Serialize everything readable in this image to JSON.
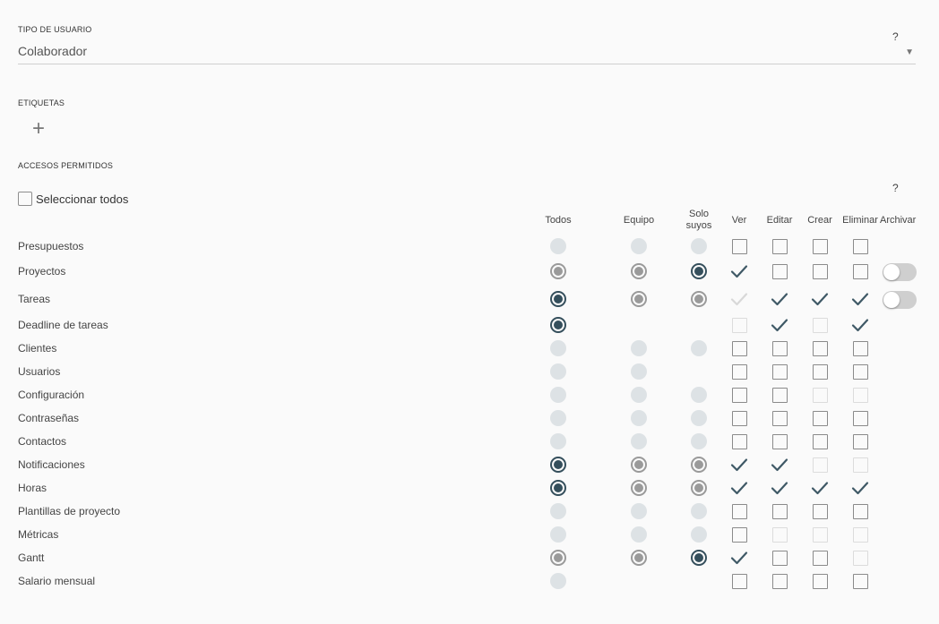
{
  "tipo_usuario": {
    "label": "TIPO DE USUARIO",
    "value": "Colaborador",
    "help": "?"
  },
  "etiquetas": {
    "label": "ETIQUETAS",
    "add": "+"
  },
  "accesos": {
    "label": "ACCESOS PERMITIDOS",
    "help": "?",
    "select_all": "Seleccionar todos",
    "columns": {
      "todos": "Todos",
      "equipo": "Equipo",
      "solo": "Solo suyos",
      "ver": "Ver",
      "editar": "Editar",
      "crear": "Crear",
      "eliminar": "Eliminar",
      "archivar": "Archivar"
    },
    "rows": [
      {
        "label": "Presupuestos",
        "radios": [
          "e",
          "e",
          "e"
        ],
        "checks": [
          "u",
          "u",
          "u",
          "u"
        ],
        "archivar": null
      },
      {
        "label": "Proyectos",
        "radios": [
          "g",
          "g",
          "s"
        ],
        "checks": [
          "c",
          "u",
          "u",
          "u"
        ],
        "archivar": "off"
      },
      {
        "label": "Tareas",
        "radios": [
          "s",
          "g",
          "g"
        ],
        "checks": [
          "cd",
          "c",
          "c",
          "c"
        ],
        "archivar": "off"
      },
      {
        "label": "Deadline de tareas",
        "radios": [
          "s",
          null,
          null
        ],
        "checks": [
          "d",
          "c",
          "d",
          "c"
        ],
        "archivar": null
      },
      {
        "label": "Clientes",
        "radios": [
          "e",
          "e",
          "e"
        ],
        "checks": [
          "u",
          "u",
          "u",
          "u"
        ],
        "archivar": null
      },
      {
        "label": "Usuarios",
        "radios": [
          "e",
          "e",
          null
        ],
        "checks": [
          "u",
          "u",
          "u",
          "u"
        ],
        "archivar": null
      },
      {
        "label": "Configuración",
        "radios": [
          "e",
          "e",
          "e"
        ],
        "checks": [
          "u",
          "u",
          "d",
          "d"
        ],
        "archivar": null
      },
      {
        "label": "Contraseñas",
        "radios": [
          "e",
          "e",
          "e"
        ],
        "checks": [
          "u",
          "u",
          "u",
          "u"
        ],
        "archivar": null
      },
      {
        "label": "Contactos",
        "radios": [
          "e",
          "e",
          "e"
        ],
        "checks": [
          "u",
          "u",
          "u",
          "u"
        ],
        "archivar": null
      },
      {
        "label": "Notificaciones",
        "radios": [
          "s",
          "g",
          "g"
        ],
        "checks": [
          "c",
          "c",
          "d",
          "d"
        ],
        "archivar": null
      },
      {
        "label": "Horas",
        "radios": [
          "s",
          "g",
          "g"
        ],
        "checks": [
          "c",
          "c",
          "c",
          "c"
        ],
        "archivar": null
      },
      {
        "label": "Plantillas de proyecto",
        "radios": [
          "e",
          "e",
          "e"
        ],
        "checks": [
          "u",
          "u",
          "u",
          "u"
        ],
        "archivar": null
      },
      {
        "label": "Métricas",
        "radios": [
          "e",
          "e",
          "e"
        ],
        "checks": [
          "u",
          "d",
          "d",
          "d"
        ],
        "archivar": null
      },
      {
        "label": "Gantt",
        "radios": [
          "g",
          "g",
          "s"
        ],
        "checks": [
          "c",
          "u",
          "u",
          "d"
        ],
        "archivar": null
      },
      {
        "label": "Salario mensual",
        "radios": [
          "e",
          null,
          null
        ],
        "checks": [
          "u",
          "u",
          "u",
          "u"
        ],
        "archivar": null
      }
    ]
  },
  "colors": {
    "selected": "#354f5c",
    "unselected": "#9a9a9a",
    "empty": "#dde2e5",
    "disabled": "#dcdcdc",
    "check_dark": "#3f5966"
  }
}
